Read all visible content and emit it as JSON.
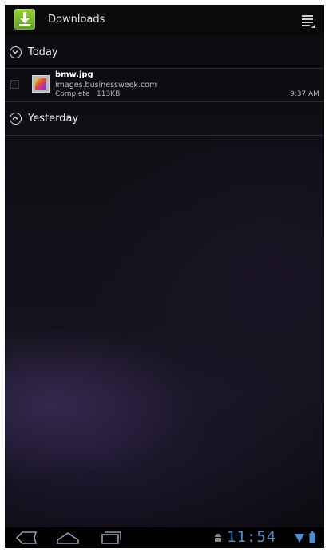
{
  "action_bar": {
    "title": "Downloads",
    "app_icon": "download-icon",
    "menu_icon": "overflow-menu-icon"
  },
  "sections": {
    "today": {
      "label": "Today",
      "icon": "chevron-down-icon"
    },
    "yesterday": {
      "label": "Yesterday",
      "icon": "chevron-up-icon"
    }
  },
  "downloads": [
    {
      "name": "bmw.jpg",
      "source": "images.businessweek.com",
      "status": "Complete",
      "size": "113KB",
      "time": "9:37 AM",
      "thumb_icon": "image-file-icon"
    }
  ],
  "system_bar": {
    "clock": "11:54",
    "icons": [
      "back-icon",
      "home-icon",
      "recent-apps-icon",
      "android-debug-icon",
      "wifi-icon",
      "battery-icon"
    ],
    "accent": "#4a8fd4"
  },
  "colors": {
    "app_icon_green": "#7cc12b",
    "background": "#0a0a0e"
  }
}
